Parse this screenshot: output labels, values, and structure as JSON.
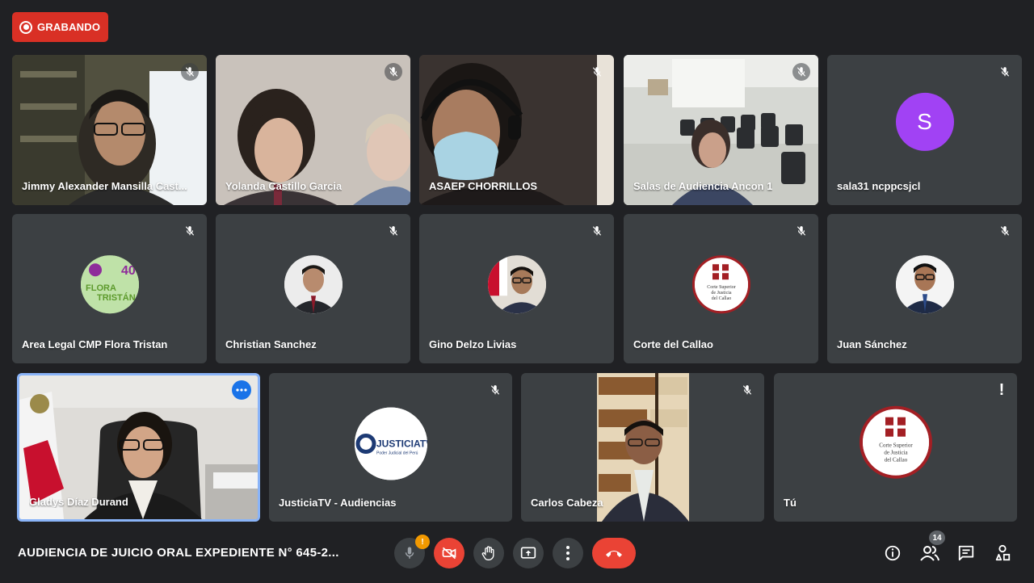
{
  "recording": {
    "label": "GRABANDO",
    "color": "#d93025"
  },
  "meeting_title": "AUDIENCIA DE JUICIO ORAL EXPEDIENTE N° 645-2...",
  "participants": [
    {
      "name": "Jimmy Alexander Mansilla Cast...",
      "muted": true
    },
    {
      "name": "Yolanda Castillo Garcia",
      "muted": true
    },
    {
      "name": "ASAEP CHORRILLOS",
      "muted": true
    },
    {
      "name": "Salas de Audiencia Ancon 1",
      "muted": true
    },
    {
      "name": "sala31 ncppcsjcl",
      "muted": true,
      "avatar_letter": "S"
    },
    {
      "name": "Area Legal CMP Flora Tristan",
      "muted": true,
      "logo_text": [
        "FLORA",
        "TRISTÁN"
      ],
      "logo_number": "40"
    },
    {
      "name": "Christian Sanchez",
      "muted": true
    },
    {
      "name": "Gino Delzo Livias",
      "muted": true
    },
    {
      "name": "Corte del Callao",
      "muted": true,
      "logo_text": [
        "Corte Superior",
        "de Justicia",
        "del Callao"
      ]
    },
    {
      "name": "Juan Sánchez",
      "muted": true
    },
    {
      "name": "Gladys Díaz Durand",
      "muted": false,
      "active_speaker": true
    },
    {
      "name": "JusticiaTV - Audiencias",
      "muted": true,
      "logo_text": [
        "JUSTICIATV",
        "Poder Judicial del Perú"
      ]
    },
    {
      "name": "Carlos Cabeza",
      "muted": true
    },
    {
      "name": "Tú",
      "muted": false,
      "logo_text": [
        "Corte Superior",
        "de Justicia",
        "del Callao"
      ]
    }
  ],
  "controls": {
    "mic_warning": "!",
    "participants_count": "14"
  },
  "colors": {
    "background": "#202124",
    "tile": "#3c4043",
    "accent_blue": "#8ab4f8",
    "danger": "#ea4335",
    "warning": "#f29900"
  },
  "icons": [
    "record-icon",
    "mic-off-icon",
    "camera-off-icon",
    "raise-hand-icon",
    "present-icon",
    "more-options-icon",
    "hang-up-icon",
    "info-icon",
    "people-icon",
    "chat-icon",
    "activities-icon"
  ]
}
